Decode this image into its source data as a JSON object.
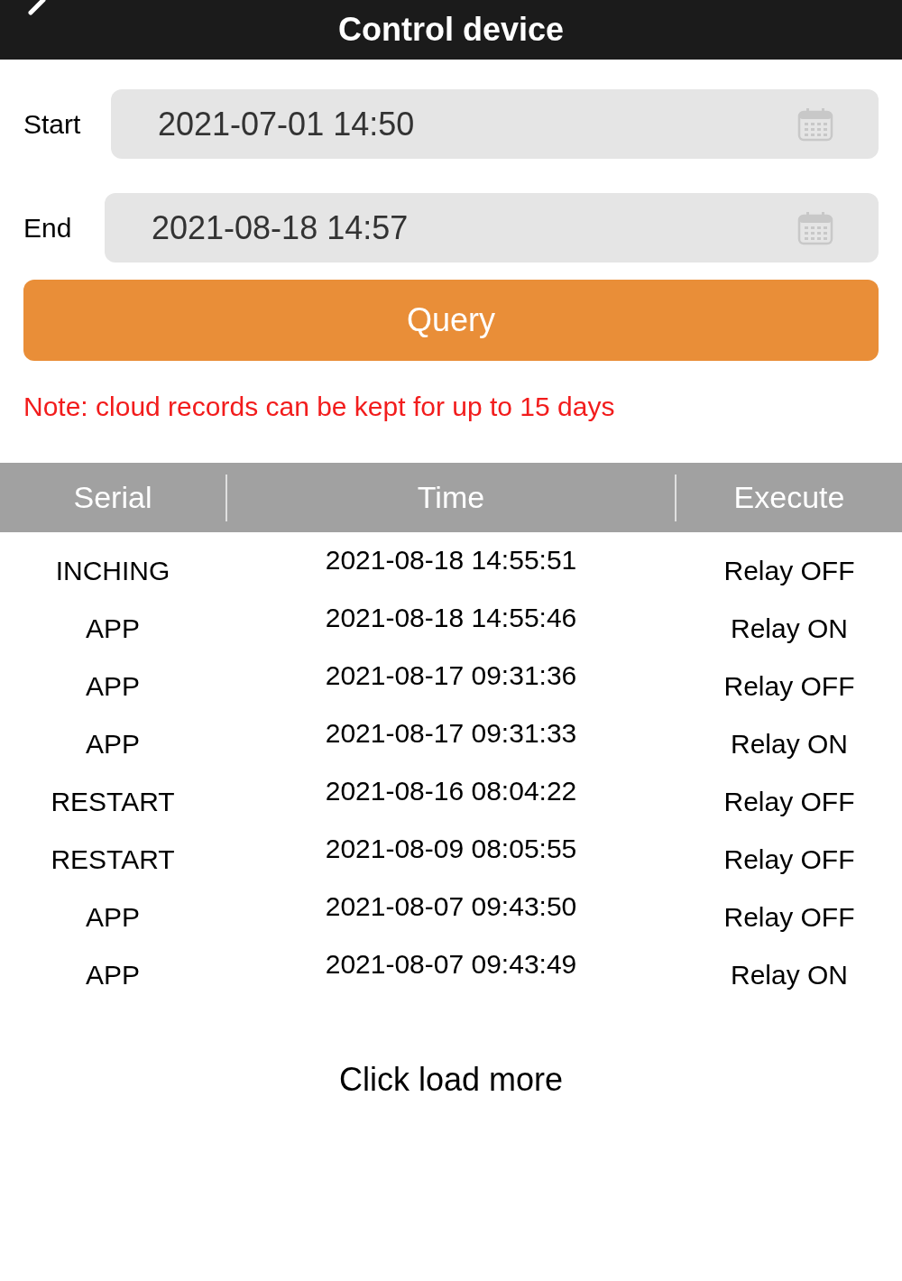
{
  "header": {
    "title": "Control device"
  },
  "filters": [
    {
      "label": "Start",
      "value": "2021-07-01 14:50"
    },
    {
      "label": "End",
      "value": "2021-08-18 14:57"
    }
  ],
  "query_button": "Query",
  "note": "Note: cloud records can be kept for up to 15 days",
  "table": {
    "columns": [
      "Serial",
      "Time",
      "Execute"
    ],
    "rows": [
      [
        "INCHING",
        "2021-08-18 14:55:51",
        "Relay OFF"
      ],
      [
        "APP",
        "2021-08-18 14:55:46",
        "Relay ON"
      ],
      [
        "APP",
        "2021-08-17 09:31:36",
        "Relay OFF"
      ],
      [
        "APP",
        "2021-08-17 09:31:33",
        "Relay ON"
      ],
      [
        "RESTART",
        "2021-08-16 08:04:22",
        "Relay OFF"
      ],
      [
        "RESTART",
        "2021-08-09 08:05:55",
        "Relay OFF"
      ],
      [
        "APP",
        "2021-08-07 09:43:50",
        "Relay OFF"
      ],
      [
        "APP",
        "2021-08-07 09:43:49",
        "Relay ON"
      ]
    ]
  },
  "load_more": "Click load more"
}
